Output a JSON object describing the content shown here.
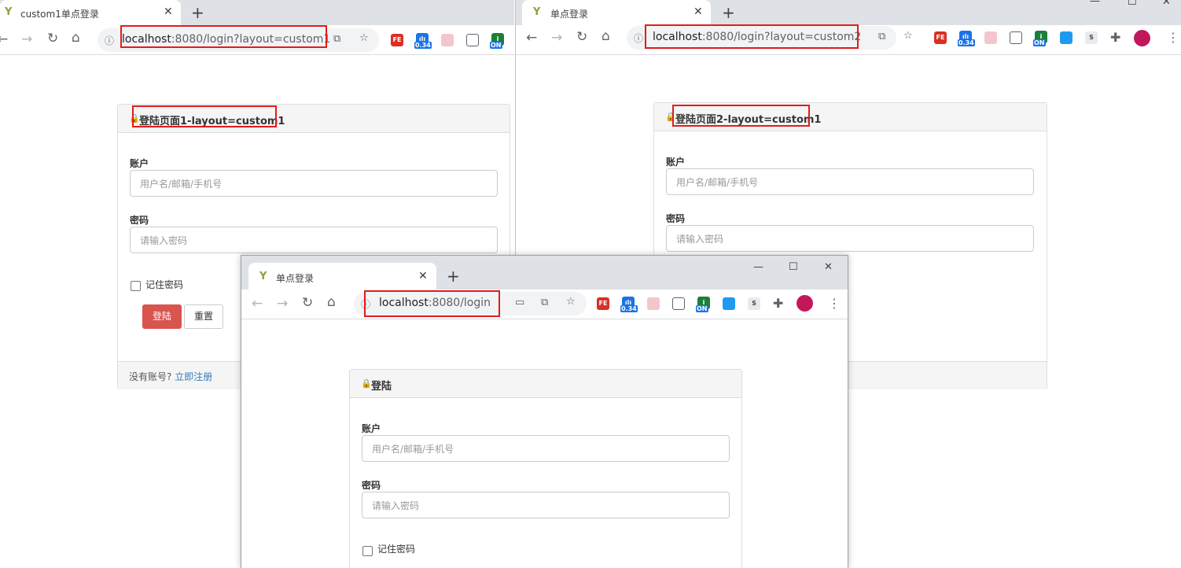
{
  "colors": {
    "highlight": "#e31b1b",
    "login_button": "#d9534f",
    "link": "#337ab7",
    "tabstrip": "#dee1e6"
  },
  "window1": {
    "tab_title": "custom1单点登录",
    "url_host": "localhost",
    "url_rest": ":8080/login?layout=custom1",
    "panel_title": "登陆页面1-layout=custom1",
    "account_label": "账户",
    "account_placeholder": "用户名/邮箱/手机号",
    "password_label": "密码",
    "password_placeholder": "请输入密码",
    "remember_label": "记住密码",
    "login_button": "登陆",
    "reset_button": "重置",
    "footer_text": "没有账号?",
    "register_link": "立即注册",
    "extensions": {
      "fe": "FE",
      "counter": "0.34",
      "on": "ON"
    }
  },
  "window2": {
    "tab_title": "单点登录",
    "url_host": "localhost",
    "url_rest": ":8080/login?layout=custom2",
    "panel_title": "登陆页面2-layout=custom1",
    "account_label": "账户",
    "account_placeholder": "用户名/邮箱/手机号",
    "password_label": "密码",
    "password_placeholder": "请输入密码",
    "extensions": {
      "fe": "FE",
      "counter": "0.34",
      "on": "ON",
      "s": "S"
    }
  },
  "window3": {
    "tab_title": "单点登录",
    "url_host": "localhost",
    "url_rest": ":8080/login",
    "panel_title": "登陆",
    "account_label": "账户",
    "account_placeholder": "用户名/邮箱/手机号",
    "password_label": "密码",
    "password_placeholder": "请输入密码",
    "remember_label": "记住密码",
    "extensions": {
      "fe": "FE",
      "counter": "0.34",
      "on": "ON",
      "s": "S"
    }
  }
}
